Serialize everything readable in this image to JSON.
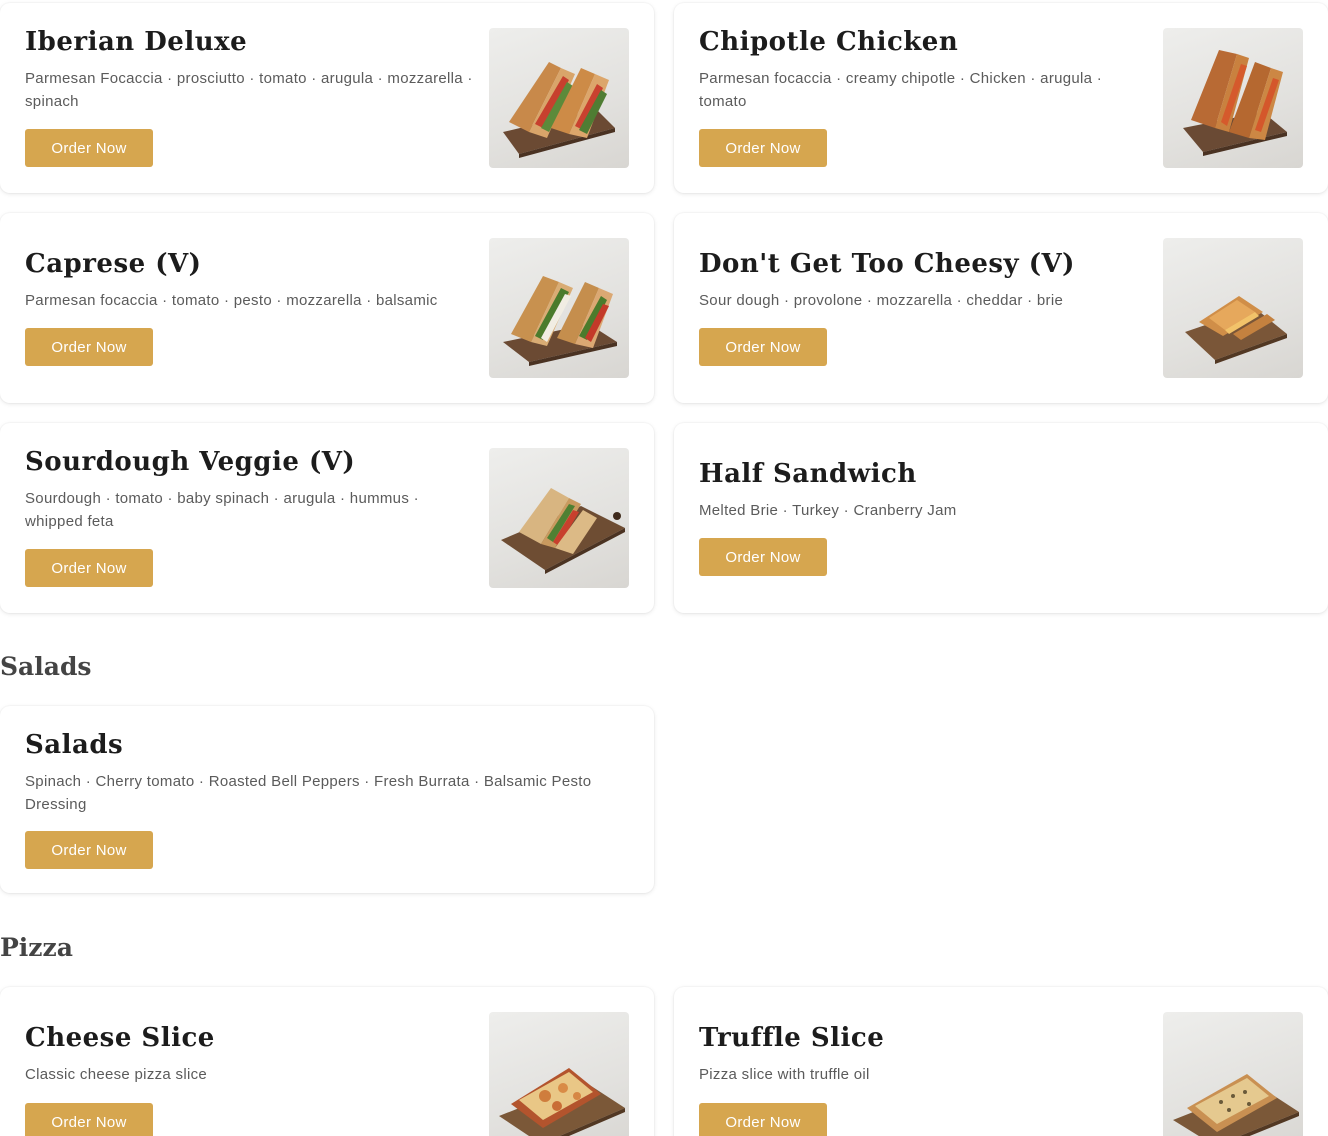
{
  "sandwiches": [
    {
      "title": "Iberian Deluxe",
      "desc": "Parmesan Focaccia · prosciutto · tomato · arugula · mozzarella · spinach",
      "button": "Order Now",
      "image_alt": "Iberian Deluxe sandwich"
    },
    {
      "title": "Chipotle Chicken",
      "desc": "Parmesan focaccia · creamy chipotle · Chicken · arugula · tomato",
      "button": "Order Now",
      "image_alt": "Chipotle Chicken sandwich"
    },
    {
      "title": "Caprese (V)",
      "desc": "Parmesan focaccia · tomato · pesto · mozzarella · balsamic",
      "button": "Order Now",
      "image_alt": "Caprese sandwich"
    },
    {
      "title": "Don't Get Too Cheesy (V)",
      "desc": "Sour dough · provolone · mozzarella · cheddar · brie",
      "button": "Order Now",
      "image_alt": "Grilled cheese sandwich"
    },
    {
      "title": "Sourdough Veggie (V)",
      "desc": "Sourdough · tomato · baby spinach · arugula · hummus · whipped feta",
      "button": "Order Now",
      "image_alt": "Sourdough veggie sandwich"
    },
    {
      "title": "Half Sandwich",
      "desc": "Melted Brie · Turkey · Cranberry Jam",
      "button": "Order Now"
    }
  ],
  "salads_section": {
    "heading": "Salads",
    "items": [
      {
        "title": "Salads",
        "desc": "Spinach · Cherry tomato · Roasted Bell Peppers · Fresh Burrata · Balsamic Pesto Dressing",
        "button": "Order Now"
      }
    ]
  },
  "pizza_section": {
    "heading": "Pizza",
    "items": [
      {
        "title": "Cheese Slice",
        "desc": "Classic cheese pizza slice",
        "button": "Order Now",
        "image_alt": "Cheese pizza slice"
      },
      {
        "title": "Truffle Slice",
        "desc": "Pizza slice with truffle oil",
        "button": "Order Now",
        "image_alt": "Truffle pizza slice"
      }
    ]
  },
  "colors": {
    "button_bg": "#d6a64f",
    "button_text": "#ffffff",
    "title_text": "#1c1c1c",
    "desc_text": "#5b5b5b",
    "section_heading": "#444444"
  }
}
